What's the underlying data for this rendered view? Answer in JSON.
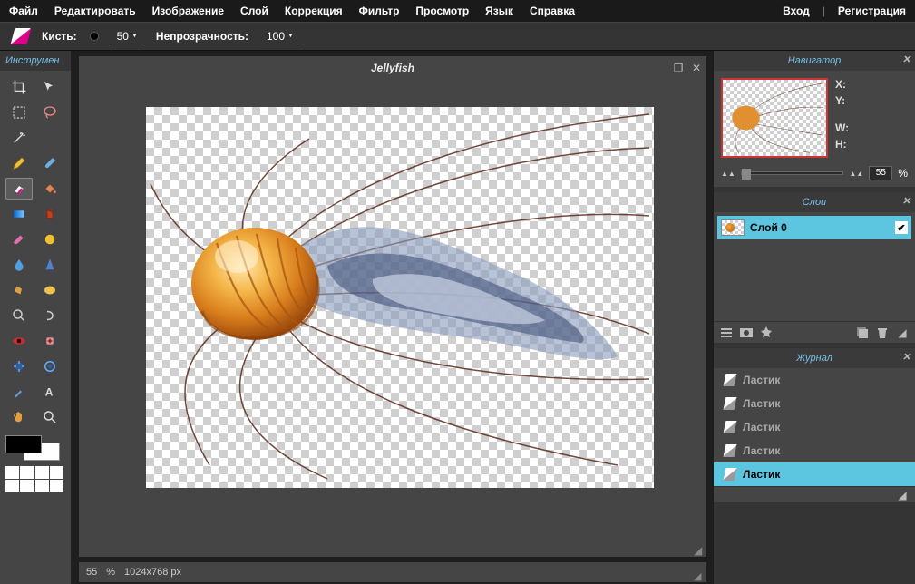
{
  "menubar": {
    "items": [
      "Файл",
      "Редактировать",
      "Изображение",
      "Слой",
      "Коррекция",
      "Фильтр",
      "Просмотр",
      "Язык",
      "Справка"
    ],
    "login": "Вход",
    "register": "Регистрация"
  },
  "optbar": {
    "brush_label": "Кисть:",
    "brush_size": "50",
    "opacity_label": "Непрозрачность:",
    "opacity_val": "100"
  },
  "toolbar": {
    "title": "Инструмен"
  },
  "document": {
    "title": "Jellyfish",
    "zoom": "55",
    "percent": "%",
    "dimensions": "1024x768 px"
  },
  "navigator": {
    "title": "Навигатор",
    "x_label": "X:",
    "y_label": "Y:",
    "w_label": "W:",
    "h_label": "H:",
    "zoom": "55",
    "percent": "%"
  },
  "layers": {
    "title": "Слои",
    "items": [
      {
        "name": "Слой 0"
      }
    ]
  },
  "journal": {
    "title": "Журнал",
    "items": [
      "Ластик",
      "Ластик",
      "Ластик",
      "Ластик",
      "Ластик"
    ]
  }
}
